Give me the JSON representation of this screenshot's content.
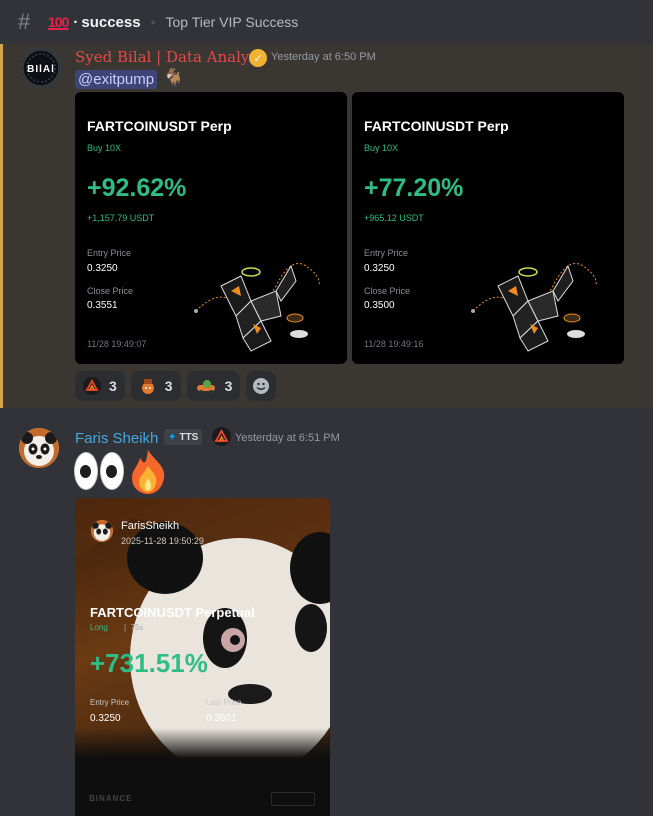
{
  "header": {
    "hash": "#",
    "channel_emoji": "💯",
    "channel_name": "success",
    "topic": "Top Tier VIP Success"
  },
  "message1": {
    "avatar_text": "bilal",
    "username": "Syed Bilal | Data Analyst",
    "verified_icon": "checkmark",
    "timestamp": "Yesterday at 6:50 PM",
    "mention": "@exitpump",
    "goat_emoji": "🐐",
    "cards": [
      {
        "title": "FARTCOINUSDT Perp",
        "side": "Buy 10X",
        "pnl_pct": "+92.62%",
        "pnl_usdt": "+1,157.79 USDT",
        "entry_label": "Entry Price",
        "entry_value": "0.3250",
        "close_label": "Close Price",
        "close_value": "0.3551",
        "date": "11/28 19:49:07"
      },
      {
        "title": "FARTCOINUSDT Perp",
        "side": "Buy 10X",
        "pnl_pct": "+77.20%",
        "pnl_usdt": "+965.12 USDT",
        "entry_label": "Entry Price",
        "entry_value": "0.3250",
        "close_label": "Close Price",
        "close_value": "0.3500",
        "date": "11/28 19:49:16"
      }
    ],
    "reactions": [
      {
        "icon": "red-logo-icon",
        "count": "3"
      },
      {
        "icon": "character-icon",
        "count": "3"
      },
      {
        "icon": "pepe-car-icon",
        "count": "3"
      }
    ]
  },
  "message2": {
    "username": "Faris Sheikh",
    "tag": "TTS",
    "timestamp": "Yesterday at 6:51 PM",
    "emojis": [
      "👀",
      "🔥"
    ],
    "card": {
      "user": "FarisSheikh",
      "datetime": "2025-11-28 19:50:29",
      "title": "FARTCOINUSDT Perpetual",
      "side": "Long",
      "leverage": "75x",
      "pnl_pct": "+731.51%",
      "entry_label": "Entry Price",
      "entry_value": "0.3250",
      "last_label": "Last Price",
      "last_value": "0.3601",
      "footer": "BINANCE"
    }
  },
  "colors": {
    "background": "#313338",
    "highlight_bg": "#3a3733",
    "highlight_border": "#d7a54b",
    "profit_green": "#2ebd85",
    "username1": "#e34a4a",
    "username2": "#44a8dc"
  }
}
